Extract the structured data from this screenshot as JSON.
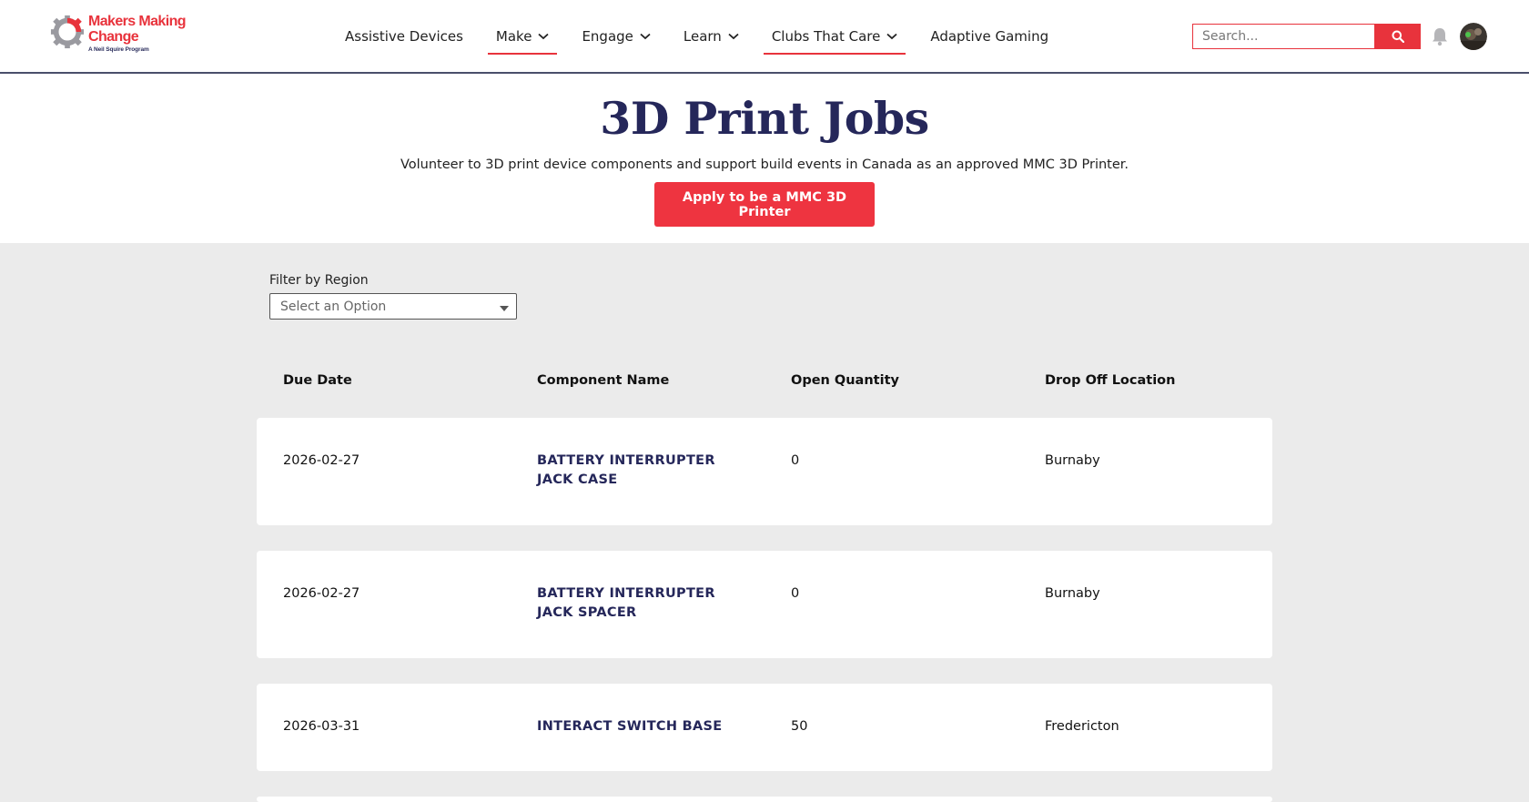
{
  "header": {
    "logo": {
      "line1": "Makers Making",
      "line2": "Change",
      "sub": "A Neil Squire Program"
    },
    "nav": [
      {
        "label": "Assistive Devices",
        "has_dropdown": false,
        "active": false
      },
      {
        "label": "Make",
        "has_dropdown": true,
        "active": true
      },
      {
        "label": "Engage",
        "has_dropdown": true,
        "active": false
      },
      {
        "label": "Learn",
        "has_dropdown": true,
        "active": false
      },
      {
        "label": "Clubs That Care",
        "has_dropdown": true,
        "active": true
      },
      {
        "label": "Adaptive Gaming",
        "has_dropdown": false,
        "active": false
      }
    ],
    "search": {
      "placeholder": "Search..."
    },
    "icons": [
      "search-icon",
      "bell-icon",
      "avatar"
    ]
  },
  "hero": {
    "title": "3D Print Jobs",
    "description": "Volunteer to 3D print device components and support build events in Canada as an approved MMC 3D Printer.",
    "apply_label": "Apply to be a MMC 3D Printer"
  },
  "filter": {
    "label": "Filter by Region",
    "selected": "Select an Option"
  },
  "table": {
    "headers": [
      "Due Date",
      "Component Name",
      "Open Quantity",
      "Drop Off Location"
    ],
    "rows": [
      {
        "due_date": "2026-02-27",
        "component": "BATTERY INTERRUPTER JACK CASE",
        "quantity": "0",
        "location": "Burnaby"
      },
      {
        "due_date": "2026-02-27",
        "component": "BATTERY INTERRUPTER JACK SPACER",
        "quantity": "0",
        "location": "Burnaby"
      },
      {
        "due_date": "2026-03-31",
        "component": "INTERACT SWITCH BASE",
        "quantity": "50",
        "location": "Fredericton"
      }
    ]
  },
  "colors": {
    "brand_red": "#e8333c",
    "navy": "#25275a",
    "page_bg": "#ebebeb"
  }
}
